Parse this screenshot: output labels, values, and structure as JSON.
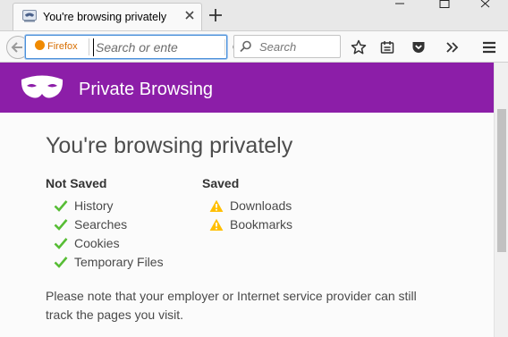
{
  "window": {
    "tab_title": "You're browsing privately",
    "tab_icon": "private-mask-icon"
  },
  "navbar": {
    "identity_label": "Firefox",
    "url_placeholder": "Search or ente",
    "search_placeholder": "Search"
  },
  "banner": {
    "title": "Private Browsing",
    "color": "#8c1ea8"
  },
  "page": {
    "heading": "You're browsing privately",
    "not_saved": {
      "title": "Not Saved",
      "items": [
        "History",
        "Searches",
        "Cookies",
        "Temporary Files"
      ],
      "icon": "check-icon",
      "icon_color": "#57bd35"
    },
    "saved": {
      "title": "Saved",
      "items": [
        "Downloads",
        "Bookmarks"
      ],
      "icon": "warning-icon",
      "icon_color": "#ffbf00"
    },
    "note": "Please note that your employer or Internet service provider can still track the pages you visit."
  }
}
